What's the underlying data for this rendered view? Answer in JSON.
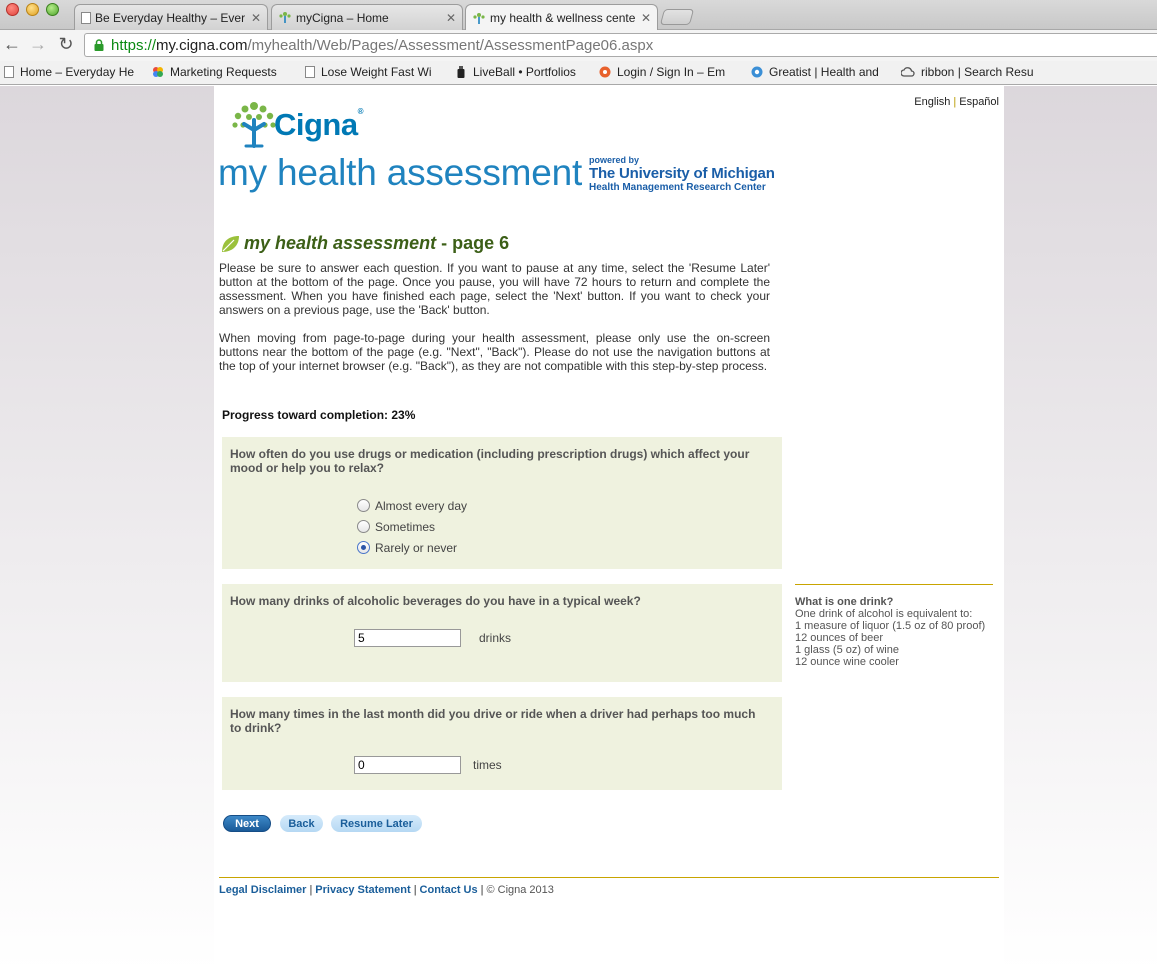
{
  "browser": {
    "tabs": [
      {
        "title": "Be Everyday Healthy – Ever",
        "icon": "doc-icon",
        "active": false
      },
      {
        "title": "myCigna – Home",
        "icon": "cigna-tree-icon",
        "active": false
      },
      {
        "title": "my health & wellness cente",
        "icon": "cigna-tree-icon",
        "active": true
      }
    ],
    "url": {
      "scheme": "https://",
      "host": "my.cigna.com",
      "path": "/myhealth/Web/Pages/Assessment/AssessmentPage06.aspx"
    },
    "bookmarks": [
      {
        "label": "Home – Everyday He",
        "icon": "doc-icon"
      },
      {
        "label": "Marketing Requests",
        "icon": "pinwheel-icon"
      },
      {
        "label": "Lose Weight Fast Wi",
        "icon": "doc-icon"
      },
      {
        "label": "LiveBall • Portfolios",
        "icon": "bottle-icon"
      },
      {
        "label": "Login / Sign In – Em",
        "icon": "orange-pin-icon"
      },
      {
        "label": "Greatist | Health and",
        "icon": "blue-circle-icon"
      },
      {
        "label": "ribbon | Search Resu",
        "icon": "cloud-icon"
      }
    ]
  },
  "header": {
    "language": {
      "english": "English",
      "separator": "|",
      "spanish": "Español"
    },
    "logo_text": "Cigna",
    "logo_reg": "®",
    "brand_title": "my health assessment",
    "partner": {
      "powered": "powered by",
      "name": "The University of Michigan",
      "center": "Health Management Research Center"
    }
  },
  "assessment": {
    "title": "my health assessment",
    "title_suffix": "- page 6",
    "intro": [
      "Please be sure to answer each question. If you want to pause at any time, select the 'Resume Later' button at the bottom of the page. Once you pause, you will have 72 hours to return and complete the assessment. When you have finished each page, select the 'Next' button. If you want to check your answers on a previous page, use the 'Back' button.",
      "When moving from page-to-page during your health assessment, please only use the on-screen buttons near the bottom of the page (e.g. \"Next\", \"Back\"). Please do not use the navigation buttons at the top of your internet browser (e.g. \"Back\"), as they are not compatible with this step-by-step process."
    ],
    "progress_label": "Progress toward completion: 23%",
    "progress_percent": 23,
    "questions": [
      {
        "text": "How often do you use drugs or medication (including prescription drugs) which affect your mood or help you to relax?",
        "options": [
          "Almost every day",
          "Sometimes",
          "Rarely or never"
        ],
        "selected": "Rarely or never"
      },
      {
        "text": "How many drinks of alcoholic beverages do you have in a typical week?",
        "value": "5",
        "unit": "drinks"
      },
      {
        "text": "How many times in the last month did you drive or ride when a driver had perhaps too much to drink?",
        "value": "0",
        "unit": "times"
      }
    ],
    "sidebar": {
      "title": "What is one drink?",
      "lines": [
        "One drink of alcohol is equivalent to:",
        "1 measure of liquor (1.5 oz of 80 proof)",
        "12 ounces of beer",
        "1 glass (5 oz) of wine",
        "12 ounce wine cooler"
      ]
    },
    "buttons": {
      "next": "Next",
      "back": "Back",
      "resume_later": "Resume Later"
    }
  },
  "footer": {
    "legal": "Legal Disclaimer",
    "privacy": "Privacy Statement",
    "contact": "Contact Us",
    "separator": "|",
    "copyright": "© Cigna 2013"
  },
  "colors": {
    "brand_blue": "#0079b5",
    "title_green": "#3c5f17",
    "question_bg": "#eff2df",
    "divider_gold": "#c8a400",
    "link_blue": "#1a5e9a"
  }
}
